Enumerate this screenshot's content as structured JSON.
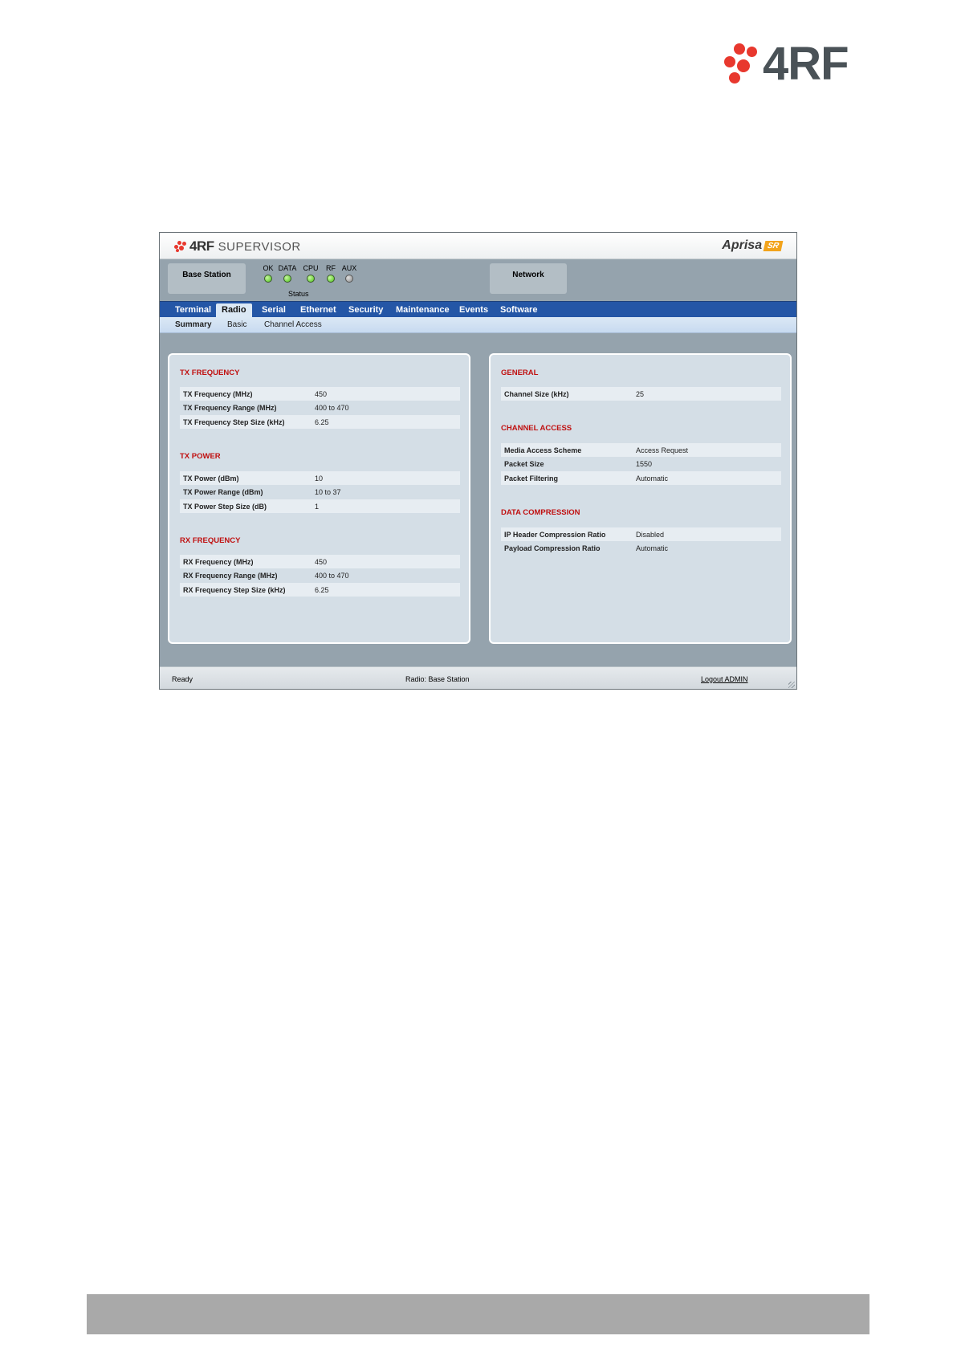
{
  "page_logo": {
    "text": "4RF"
  },
  "app": {
    "brand": "4RF",
    "product": "SUPERVISOR",
    "device_name": "Aprisa",
    "device_badge": "SR"
  },
  "status": {
    "station_label": "Base Station",
    "network_label": "Network",
    "caption": "Status",
    "leds": [
      {
        "label": "OK",
        "state": "on"
      },
      {
        "label": "DATA",
        "state": "on"
      },
      {
        "label": "CPU",
        "state": "on"
      },
      {
        "label": "RF",
        "state": "on"
      },
      {
        "label": "AUX",
        "state": "off"
      }
    ]
  },
  "tabs": [
    {
      "label": "Terminal"
    },
    {
      "label": "Radio",
      "active": true
    },
    {
      "label": "Serial"
    },
    {
      "label": "Ethernet"
    },
    {
      "label": "Security"
    },
    {
      "label": "Maintenance"
    },
    {
      "label": "Events"
    },
    {
      "label": "Software"
    }
  ],
  "subtabs": [
    {
      "label": "Summary",
      "active": true
    },
    {
      "label": "Basic"
    },
    {
      "label": "Channel Access"
    }
  ],
  "left_panel": {
    "tx_frequency": {
      "title": "TX FREQUENCY",
      "rows": [
        {
          "label": "TX Frequency (MHz)",
          "value": "450"
        },
        {
          "label": "TX Frequency Range (MHz)",
          "value": "400 to 470"
        },
        {
          "label": "TX Frequency Step Size (kHz)",
          "value": "6.25"
        }
      ]
    },
    "tx_power": {
      "title": "TX POWER",
      "rows": [
        {
          "label": "TX Power (dBm)",
          "value": "10"
        },
        {
          "label": "TX Power Range (dBm)",
          "value": "10 to 37"
        },
        {
          "label": "TX Power Step Size (dB)",
          "value": "1"
        }
      ]
    },
    "rx_frequency": {
      "title": "RX FREQUENCY",
      "rows": [
        {
          "label": "RX Frequency (MHz)",
          "value": "450"
        },
        {
          "label": "RX Frequency Range (MHz)",
          "value": "400 to 470"
        },
        {
          "label": "RX Frequency Step Size (kHz)",
          "value": "6.25"
        }
      ]
    }
  },
  "right_panel": {
    "general": {
      "title": "GENERAL",
      "rows": [
        {
          "label": "Channel Size (kHz)",
          "value": "25"
        }
      ]
    },
    "channel_access": {
      "title": "CHANNEL ACCESS",
      "rows": [
        {
          "label": "Media Access Scheme",
          "value": "Access Request"
        },
        {
          "label": "Packet Size",
          "value": "1550"
        },
        {
          "label": "Packet Filtering",
          "value": "Automatic"
        }
      ]
    },
    "data_compression": {
      "title": "DATA COMPRESSION",
      "rows": [
        {
          "label": "IP Header Compression Ratio",
          "value": "Disabled"
        },
        {
          "label": "Payload Compression Ratio",
          "value": "Automatic"
        }
      ]
    }
  },
  "footer": {
    "status": "Ready",
    "radio": "Radio: Base Station",
    "logout": "Logout ADMIN"
  },
  "colors": {
    "section_title": "#c01010",
    "tab_bar": "#2456a6",
    "logo_red": "#e8382e"
  }
}
